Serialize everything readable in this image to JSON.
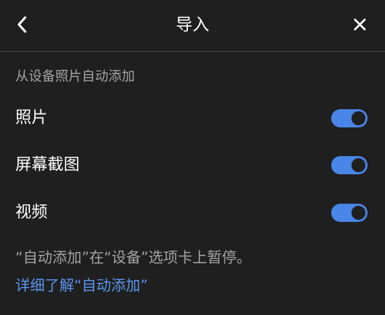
{
  "header": {
    "title": "导入",
    "back_icon": "chevron-left-icon",
    "close_icon": "close-icon"
  },
  "section": {
    "label": "从设备照片自动添加"
  },
  "toggles": [
    {
      "label": "照片",
      "on": true
    },
    {
      "label": "屏幕截图",
      "on": true
    },
    {
      "label": "视频",
      "on": true
    }
  ],
  "note": "“自动添加”在“设备”选项卡上暂停。",
  "link": "详细了解“自动添加”",
  "colors": {
    "background": "#1f1f1f",
    "accent": "#4a85e8",
    "link": "#5b95f0",
    "muted_text": "#a3a3a3"
  }
}
